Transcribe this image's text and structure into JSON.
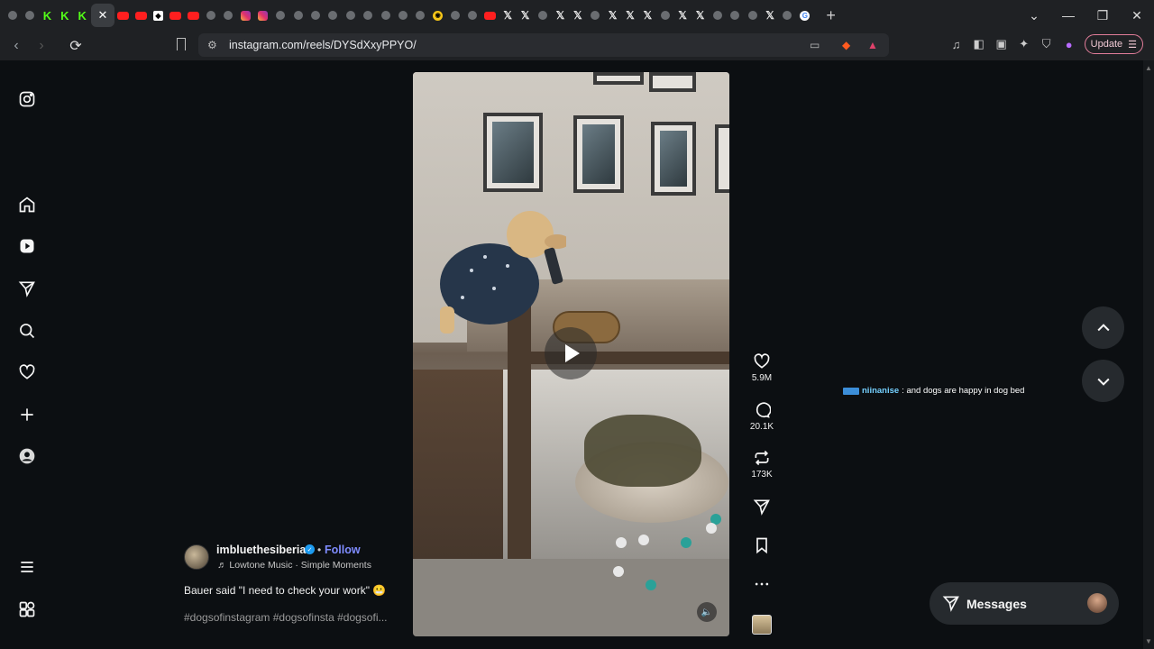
{
  "browser": {
    "url": "instagram.com/reels/DYSdXxyPPYO/",
    "update_label": "Update",
    "tabs": [
      "globe",
      "globe",
      "kick",
      "kick",
      "kick",
      "active",
      "yt",
      "yt",
      "dark",
      "yt",
      "yt",
      "globe",
      "globe",
      "ig",
      "ig",
      "globe",
      "globe",
      "globe",
      "globe",
      "globe",
      "globe",
      "globe",
      "globe",
      "globe",
      "yel",
      "globe",
      "globe",
      "yt",
      "x",
      "x",
      "globe",
      "x",
      "x",
      "globe",
      "x",
      "x",
      "x",
      "globe",
      "x",
      "x",
      "globe",
      "globe",
      "globe",
      "x",
      "globe",
      "g"
    ]
  },
  "sidebar": {
    "icons": [
      "instagram-logo-icon",
      "home-icon",
      "reels-icon",
      "messages-icon",
      "search-icon",
      "notifications-icon",
      "create-icon",
      "profile-icon",
      "more-menu-icon",
      "also-from-meta-icon"
    ]
  },
  "post": {
    "username": "imbluethesiberian",
    "follow_label": "Follow",
    "separator": "•",
    "music": "♬ Lowtone Music · Simple Moments",
    "caption": "Bauer said \"I need to check your work\" 😬",
    "hashtags": "#dogsofinstagram #dogsofinsta #dogsofi..."
  },
  "actions": {
    "likes": "5.9M",
    "comments": "20.1K",
    "reposts": "173K"
  },
  "floating_comment": {
    "user": "niinanise",
    "text": ": and dogs are happy in dog bed"
  },
  "messages": {
    "label": "Messages"
  },
  "colors": {
    "background": "#0c0f12",
    "accent_link": "#7f8cff",
    "verified": "#1d9bf0"
  }
}
